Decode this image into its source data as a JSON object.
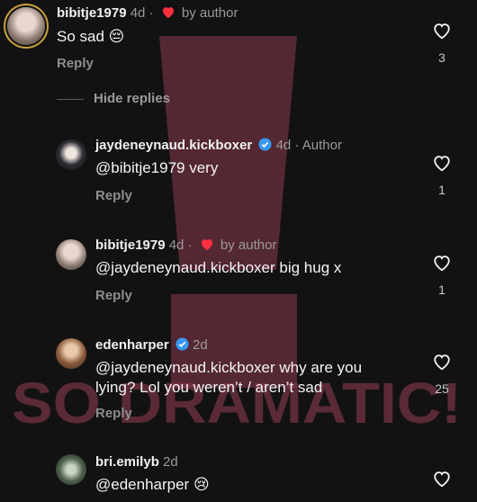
{
  "overlay": {
    "text": "SO DRAMATIC!",
    "color": "#8b3a4e"
  },
  "comments": [
    {
      "username": "bibitje1979",
      "time": "4d",
      "badge": "by author",
      "text": "So sad 😔",
      "reply_label": "Reply",
      "like_count": "3"
    },
    {
      "username": "jaydeneynaud.kickboxer",
      "time": "4d",
      "badge": "Author",
      "text": "@bibitje1979 very",
      "reply_label": "Reply",
      "like_count": "1"
    },
    {
      "username": "bibitje1979",
      "time": "4d",
      "badge": "by author",
      "text": "@jaydeneynaud.kickboxer big hug x",
      "reply_label": "Reply",
      "like_count": "1"
    },
    {
      "username": "edenharper",
      "time": "2d",
      "text_line1": "@jaydeneynaud.kickboxer why are you",
      "text_line2": "lying? Lol you weren’t / aren’t sad",
      "reply_label": "Reply",
      "like_count": "25"
    },
    {
      "username": "bri.emilyb",
      "time": "2d",
      "text": "@edenharper 😢"
    }
  ],
  "hide_replies": "Hide replies",
  "colors": {
    "background": "#121212",
    "heart": "#ff3040",
    "verified": "#3897f0"
  }
}
